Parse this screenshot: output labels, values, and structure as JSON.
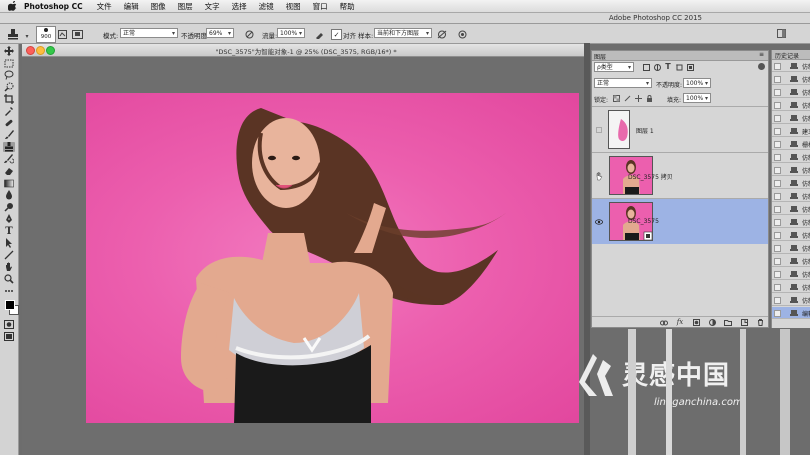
{
  "menubar": {
    "app_name": "Photoshop CC",
    "items": [
      "文件",
      "编辑",
      "图像",
      "图层",
      "文字",
      "选择",
      "滤镜",
      "视图",
      "窗口",
      "帮助"
    ]
  },
  "app_title": "Adobe Photoshop CC 2015",
  "options": {
    "brush_size": "900",
    "mode_label": "模式:",
    "mode_value": "正常",
    "opacity_label": "不透明度:",
    "opacity_value": "69%",
    "flow_label": "流量:",
    "flow_value": "100%",
    "align_label": "对齐",
    "sample_label": "样本:",
    "sample_value": "当前和下方图层"
  },
  "document": {
    "title": "\"DSC_3575\"为智能对象-1 @ 25% (DSC_3575, RGB/16*) *"
  },
  "layers_panel": {
    "tab": "图层",
    "filter_value": "ρ类型",
    "blend_value": "正常",
    "opacity_label": "不透明度:",
    "opacity_value": "100%",
    "lock_label": "锁定:",
    "fill_label": "填充:",
    "fill_value": "100%",
    "layers": [
      {
        "name": "图层 1",
        "visible": false,
        "selected": false
      },
      {
        "name": "DSC_3575 拷贝",
        "visible": false,
        "selected": false
      },
      {
        "name": "DSC_3575",
        "visible": true,
        "selected": true
      }
    ]
  },
  "history_panel": {
    "tab": "历史记录",
    "items": [
      "仿制",
      "仿制",
      "仿制",
      "仿制",
      "仿制",
      "建立",
      "栅格",
      "仿制",
      "仿制",
      "仿制",
      "仿制",
      "仿制",
      "仿制",
      "仿制",
      "仿制",
      "仿制",
      "仿制",
      "仿制",
      "仿制",
      "编辑"
    ]
  },
  "watermark": {
    "brand": "灵感中国",
    "url": "lingganchina.com"
  },
  "colors": {
    "canvas_bg": "#ec5fae",
    "selection": "#9db3e4"
  }
}
